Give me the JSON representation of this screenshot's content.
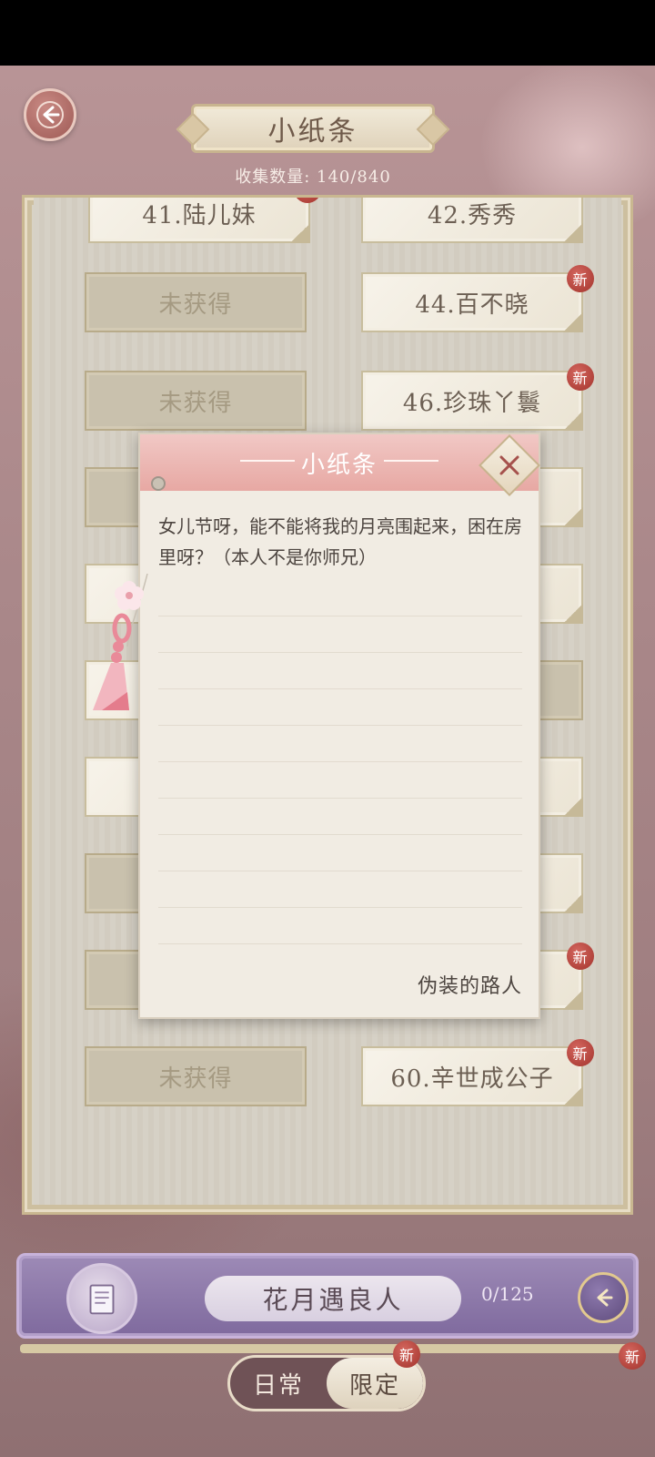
{
  "header": {
    "title": "小纸条",
    "collect_label": "收集数量: 140/840"
  },
  "notes_list": {
    "rows": [
      [
        {
          "label": "41.陆儿妹",
          "state": "owned",
          "new": true
        },
        {
          "label": "42.秀秀",
          "state": "owned",
          "new": false
        }
      ],
      [
        {
          "label": "未获得",
          "state": "locked",
          "new": false
        },
        {
          "label": "44.百不晓",
          "state": "owned",
          "new": true
        }
      ],
      [
        {
          "label": "未获得",
          "state": "locked",
          "new": false
        },
        {
          "label": "46.珍珠丫鬟",
          "state": "owned",
          "new": true
        }
      ],
      [
        {
          "label": "未获得",
          "state": "locked",
          "new": false
        },
        {
          "label": "60.辛世成公子",
          "state": "owned",
          "new": true
        }
      ]
    ],
    "new_badge_text": "新"
  },
  "note_popup": {
    "title": "小纸条",
    "body": "女儿节呀，能不能将我的月亮围起来，困在房里呀？（本人不是你师兄）",
    "signature": "伪装的路人"
  },
  "banner": {
    "title": "花月遇良人",
    "count": "0/125"
  },
  "tabs": {
    "daily": "日常",
    "limited": "限定",
    "badge": "新"
  },
  "colors": {
    "accent_pink": "#e7a8a3",
    "badge_red": "#a3332c",
    "banner_purple": "#7f6a9e"
  }
}
